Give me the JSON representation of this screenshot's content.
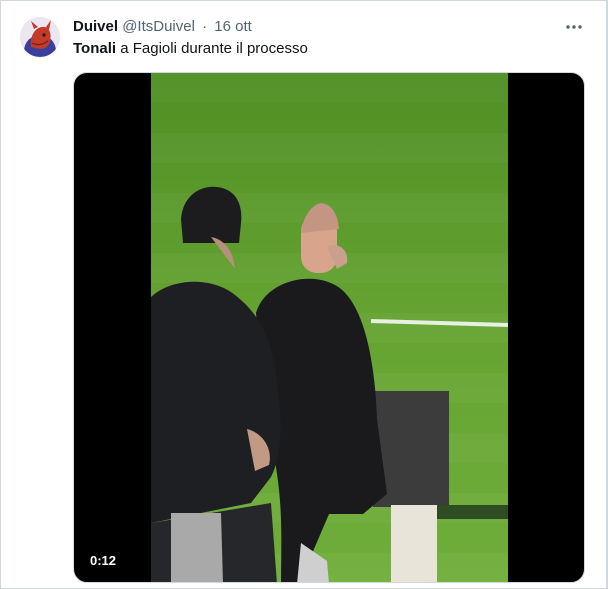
{
  "tweet": {
    "display_name": "Duivel",
    "handle": "@ItsDuivel",
    "separator": "·",
    "timestamp": "16 ott",
    "more_icon": "more-horizontal-icon",
    "text_bold": "Tonali",
    "text_rest": " a Fagioli durante il processo",
    "avatar_icon": "devil-avatar"
  },
  "media": {
    "duration": "0:12",
    "colors": {
      "pitch": "#5a9a2c",
      "pitch_light": "#6aab36",
      "background": "#000000"
    }
  },
  "colors": {
    "text_primary": "#0f1419",
    "text_secondary": "#536471",
    "border": "#cfd9de"
  }
}
